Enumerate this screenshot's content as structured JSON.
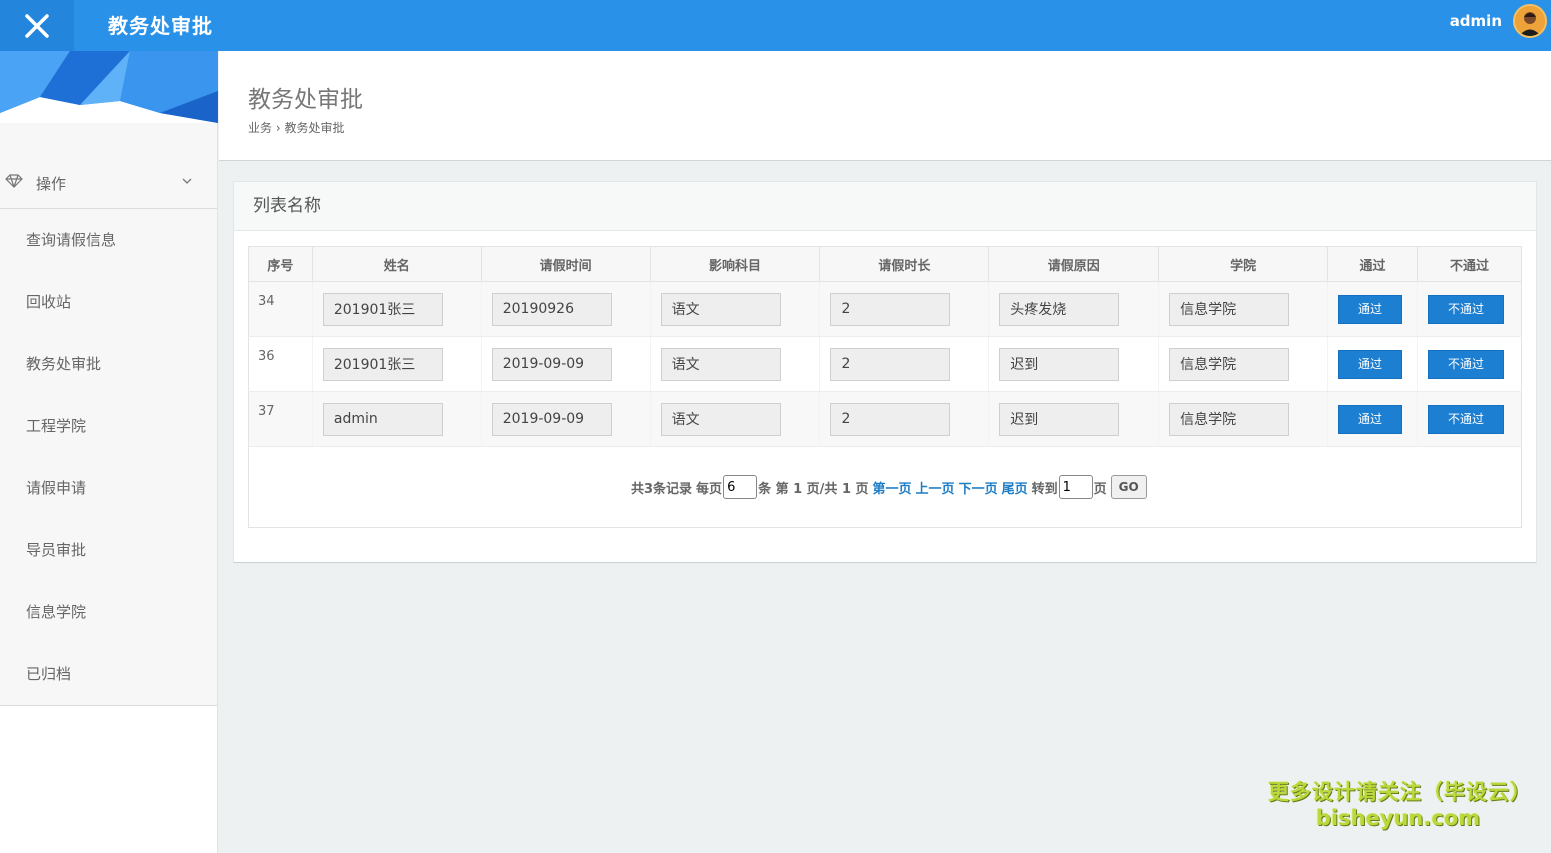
{
  "topbar": {
    "title": "教务处审批",
    "username": "admin",
    "close_icon": "close-icon",
    "accent": "#2a91e8"
  },
  "sidebar": {
    "section_label": "操作",
    "section_icon": "diamond-icon",
    "items": [
      {
        "label": "查询请假信息"
      },
      {
        "label": "回收站"
      },
      {
        "label": "教务处审批"
      },
      {
        "label": "工程学院"
      },
      {
        "label": "请假申请"
      },
      {
        "label": "导员审批"
      },
      {
        "label": "信息学院"
      },
      {
        "label": "已归档"
      }
    ]
  },
  "page": {
    "title": "教务处审批",
    "breadcrumb": {
      "parent": "业务",
      "separator": "›",
      "current": "教务处审批"
    }
  },
  "panel": {
    "title": "列表名称",
    "columns": [
      "序号",
      "姓名",
      "请假时间",
      "影响科目",
      "请假时长",
      "请假原因",
      "学院",
      "通过",
      "不通过"
    ],
    "rows": [
      {
        "id": "34",
        "name": "201901张三",
        "date": "20190926",
        "subject": "语文",
        "duration": "2",
        "reason": "头疼发烧",
        "college": "信息学院",
        "pass": "通过",
        "fail": "不通过"
      },
      {
        "id": "36",
        "name": "201901张三",
        "date": "2019-09-09",
        "subject": "语文",
        "duration": "2",
        "reason": "迟到",
        "college": "信息学院",
        "pass": "通过",
        "fail": "不通过"
      },
      {
        "id": "37",
        "name": "admin",
        "date": "2019-09-09",
        "subject": "语文",
        "duration": "2",
        "reason": "迟到",
        "college": "信息学院",
        "pass": "通过",
        "fail": "不通过"
      }
    ]
  },
  "pager": {
    "total_text": "共3条记录",
    "per_page_label": "每页",
    "per_page_value": "6",
    "unit_text": "条 第 1 页/共 1 页",
    "first": "第一页",
    "prev": "上一页",
    "next": "下一页",
    "last": "尾页",
    "goto_label": "转到",
    "goto_value": "1",
    "page_suffix": "页",
    "go_label": "GO"
  },
  "watermark": {
    "line1": "更多设计请关注（毕设云）",
    "line2": "bisheyun.com"
  }
}
